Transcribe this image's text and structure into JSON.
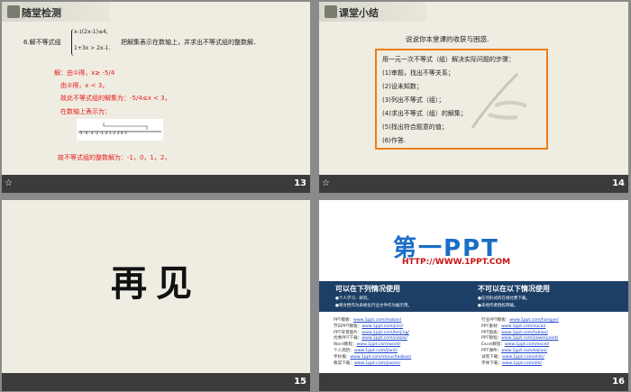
{
  "slides": [
    {
      "page": "13",
      "title": "随堂检测",
      "question_prefix": "6.解不等式组",
      "system_line1": "x-",
      "system_line1b": "(2x-1)≤4,",
      "system_line2": "1+3x",
      "system_line2b": "> 2x-1.",
      "question_suffix": "把解集表示在数轴上，并求出不等式组的整数解．",
      "sol_1": "解：由①得，x≥ -",
      "sol_2": "由②得，x < 3，",
      "sol_3": "故此不等式组的解集为：-",
      "sol_3b": "≤x < 3，",
      "sol_4": "在数轴上表示为：",
      "numline_labels": "-5 -4 -3 -2 -1  0  1  2  3  4  5",
      "sol_5": "故不等式组的整数解为：-1，0，1，2，",
      "frac_num": "5",
      "frac_den": "4",
      "frac_num2": "1",
      "frac_den2": "2"
    },
    {
      "page": "14",
      "title": "课堂小结",
      "intro": "说说你本堂课的收获与困惑.",
      "box_lines": [
        "用一元一次不等式（组）解决实际问题的步骤：",
        "(1)审题，找出不等关系；",
        "(2)设未知数；",
        "(3)列出不等式（组）；",
        "(4)求出不等式（组）的解集；",
        "(5)找出符合题意的值；",
        "(6)作答."
      ]
    },
    {
      "page": "15",
      "big_text": "再见"
    },
    {
      "page": "16",
      "logo": "第一PPT",
      "url": "HTTP://WWW.1PPT.COM",
      "left_title": "可以在下列情况使用",
      "left_sub1": "●个人学习、研究。",
      "left_sub2": "●将文档作为表格化行业文件作为展示用。",
      "right_title": "不可以在以下情况使用",
      "right_sub1": "●任何形式的在线付费下载。",
      "right_sub2": "●未经作者授权转载。",
      "links_left": [
        {
          "k": "PPT模板：",
          "v": "www.1ppt.com/moban/"
        },
        {
          "k": "节日PPT模板：",
          "v": "www.1ppt.com/jieri/"
        },
        {
          "k": "PPT背景图片：",
          "v": "www.1ppt.com/beijing/"
        },
        {
          "k": "优秀PPT下载：",
          "v": "www.1ppt.com/xiazai/"
        },
        {
          "k": "Word教程：",
          "v": "www.1ppt.com/word/"
        },
        {
          "k": "个人简历：",
          "v": "www.1ppt.com/jianli/"
        },
        {
          "k": "手抄报：",
          "v": "www.1ppt.com/shouchaobao/"
        },
        {
          "k": "教案下载：",
          "v": "www.1ppt.com/jiaoan/"
        }
      ],
      "links_right": [
        {
          "k": "行业PPT模板：",
          "v": "www.1ppt.com/hangye/"
        },
        {
          "k": "PPT素材：",
          "v": "www.1ppt.com/sucai/"
        },
        {
          "k": "PPT图表：",
          "v": "www.1ppt.com/tubiao/"
        },
        {
          "k": "PPT教程：",
          "v": "www.1ppt.com/powerpoint/"
        },
        {
          "k": "Excel教程：",
          "v": "www.1ppt.com/excel/"
        },
        {
          "k": "PPT课件：",
          "v": "www.1ppt.com/kejian/"
        },
        {
          "k": "试卷下载：",
          "v": "www.1ppt.com/shiti/"
        },
        {
          "k": "字体下载：",
          "v": "www.1ppt.com/ziti/"
        }
      ]
    }
  ],
  "footer_icon": "☆"
}
